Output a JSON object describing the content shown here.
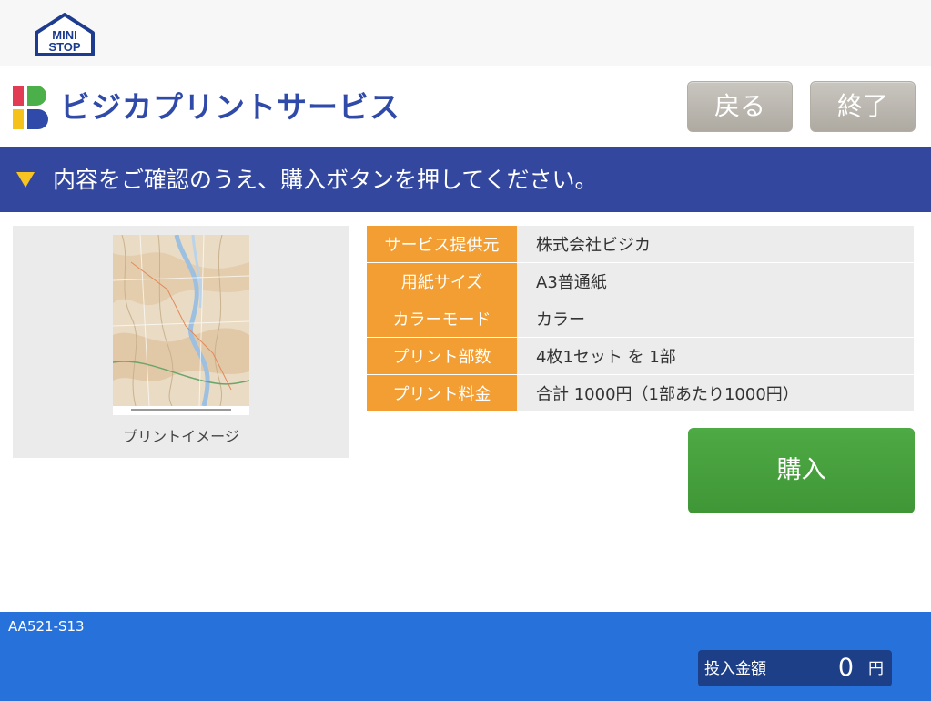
{
  "top": {
    "logo_line1": "MINI",
    "logo_line2": "STOP"
  },
  "header": {
    "service_title": "ビジカプリントサービス",
    "back_label": "戻る",
    "end_label": "終了"
  },
  "banner": {
    "message": "内容をご確認のうえ、購入ボタンを押してください。"
  },
  "preview": {
    "caption": "プリントイメージ"
  },
  "details": [
    {
      "label": "サービス提供元",
      "value": "株式会社ビジカ"
    },
    {
      "label": "用紙サイズ",
      "value": "A3普通紙"
    },
    {
      "label": "カラーモード",
      "value": "カラー"
    },
    {
      "label": "プリント部数",
      "value": "4枚1セット を 1部"
    },
    {
      "label": "プリント料金",
      "value": "合計 1000円（1部あたり1000円）"
    }
  ],
  "purchase": {
    "label": "購入"
  },
  "footer": {
    "terminal_code": "AA521-S13",
    "deposit_label": "投入金額",
    "deposit_amount": "0",
    "deposit_unit": "円"
  },
  "colors": {
    "brand_blue": "#2f4aa8",
    "banner_bg": "#33479e",
    "accent_orange": "#f29e32",
    "buy_green": "#46a13c",
    "footer_blue": "#2771db"
  }
}
